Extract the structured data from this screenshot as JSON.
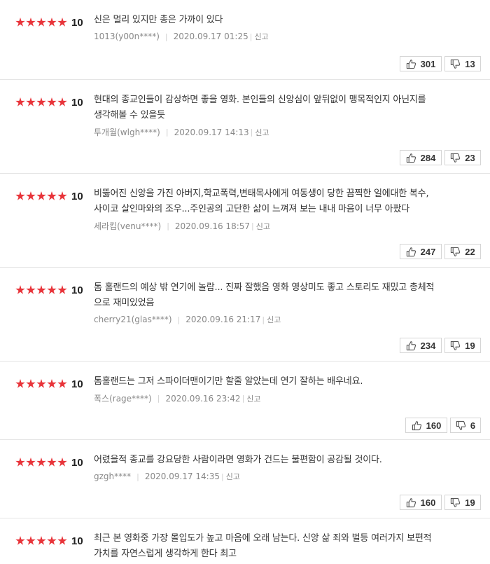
{
  "reviews": [
    {
      "score": "10",
      "stars": 5,
      "comment_lines": [
        "신은 멀리 있지만 총은 가까이 있다"
      ],
      "author": "1013(y00n****)",
      "date": "2020.09.17 01:25",
      "report": "신고",
      "likes": "301",
      "dislikes": "13"
    },
    {
      "score": "10",
      "stars": 5,
      "comment_lines": [
        "현대의 종교인들이 감상하면 좋을 영화. 본인들의 신앙심이 앞뒤없이 맹목적인지 아닌지를",
        "생각해볼 수 있을듯"
      ],
      "author": "투개월(wlgh****)",
      "date": "2020.09.17 14:13",
      "report": "신고",
      "likes": "284",
      "dislikes": "23"
    },
    {
      "score": "10",
      "stars": 5,
      "comment_lines": [
        "비뚫어진 신앙을 가진 아버지,학교폭력,변태목사에게 여동생이 당한 끔찍한 일에대한 복수,",
        "사이코 살인마와의 조우...주인공의 고단한 삶이 느껴져 보는 내내 마음이 너무 아팠다"
      ],
      "author": "세라킴(venu****)",
      "date": "2020.09.16 18:57",
      "report": "신고",
      "likes": "247",
      "dislikes": "22"
    },
    {
      "score": "10",
      "stars": 5,
      "comment_lines": [
        "톰 홀랜드의 예상 밖 연기에 놀람... 진짜 잘했음 영화 영상미도 좋고 스토리도 재밌고 총체적",
        "으로 재미있었음"
      ],
      "author": "cherry21(glas****)",
      "date": "2020.09.16 21:17",
      "report": "신고",
      "likes": "234",
      "dislikes": "19"
    },
    {
      "score": "10",
      "stars": 5,
      "comment_lines": [
        "톰홀랜드는 그저 스파이더맨이기만 할줄 알았는데 연기 잘하는 배우네요."
      ],
      "author": "폭스(rage****)",
      "date": "2020.09.16 23:42",
      "report": "신고",
      "likes": "160",
      "dislikes": "6"
    },
    {
      "score": "10",
      "stars": 5,
      "comment_lines": [
        "어렸을적 종교를 강요당한 사람이라면 영화가 건드는 불편함이 공감될 것이다."
      ],
      "author": "gzgh****",
      "date": "2020.09.17 14:35",
      "report": "신고",
      "likes": "160",
      "dislikes": "19"
    },
    {
      "score": "10",
      "stars": 5,
      "comment_lines": [
        "최근 본 영화중 가장 몰입도가 높고 마음에 오래 남는다. 신앙 삶 죄와 벌등 여러가지 보편적",
        "가치를 자연스럽게 생각하게 한다 최고"
      ],
      "author": "",
      "date": "",
      "report": "",
      "likes": "",
      "dislikes": ""
    }
  ]
}
